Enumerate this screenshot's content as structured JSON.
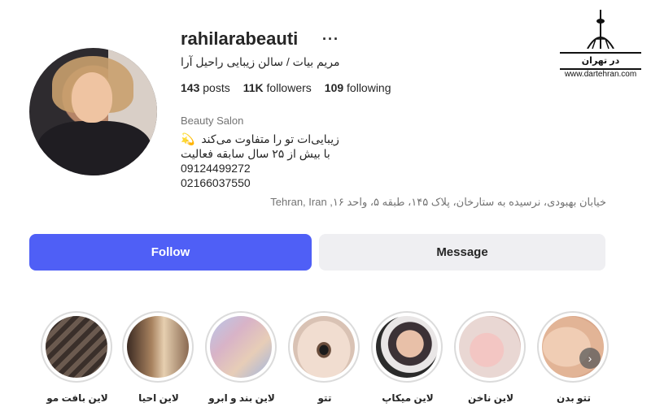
{
  "profile": {
    "username": "rahilarabeauti",
    "full_name": "مریم بیات / سالن زیبایی راحیل آرا",
    "stats": {
      "posts_count": "143",
      "posts_label": "posts",
      "followers_count": "11K",
      "followers_label": "followers",
      "following_count": "109",
      "following_label": "following"
    },
    "category": "Beauty Salon",
    "bio": {
      "line1": "زیبایی‌ات تو را متفاوت می‌کند",
      "line1_emoji": "💫",
      "line2": "با بیش از ۲۵ سال سابقه فعالیت",
      "phone1": "09124499272",
      "phone2": "02166037550"
    },
    "address": "خیابان بهبودی، نرسیده به ستارخان، پلاک ۱۴۵، طبقه ۵، واحد ۱۶, Tehran, Iran"
  },
  "watermark": {
    "brand": "در تهران",
    "url": "www.dartehran.com"
  },
  "actions": {
    "follow_label": "Follow",
    "message_label": "Message"
  },
  "highlights": [
    {
      "label": "لاین بافت مو",
      "icon": "braided-hair-thumbnail"
    },
    {
      "label": "لاین احیا",
      "icon": "straight-hair-thumbnail"
    },
    {
      "label": "لاین بند و ابرو",
      "icon": "eyebrow-collage-thumbnail"
    },
    {
      "label": "تتو",
      "icon": "eye-tattoo-thumbnail"
    },
    {
      "label": "لاین میکاپ",
      "icon": "makeup-portrait-thumbnail"
    },
    {
      "label": "لاین ناخن",
      "icon": "nails-thumbnail"
    },
    {
      "label": "تتو بدن",
      "icon": "body-tattoo-thumbnail"
    }
  ],
  "colors": {
    "follow_button": "#4f5ff6",
    "message_button": "#efeff2",
    "muted_text": "#737373"
  }
}
